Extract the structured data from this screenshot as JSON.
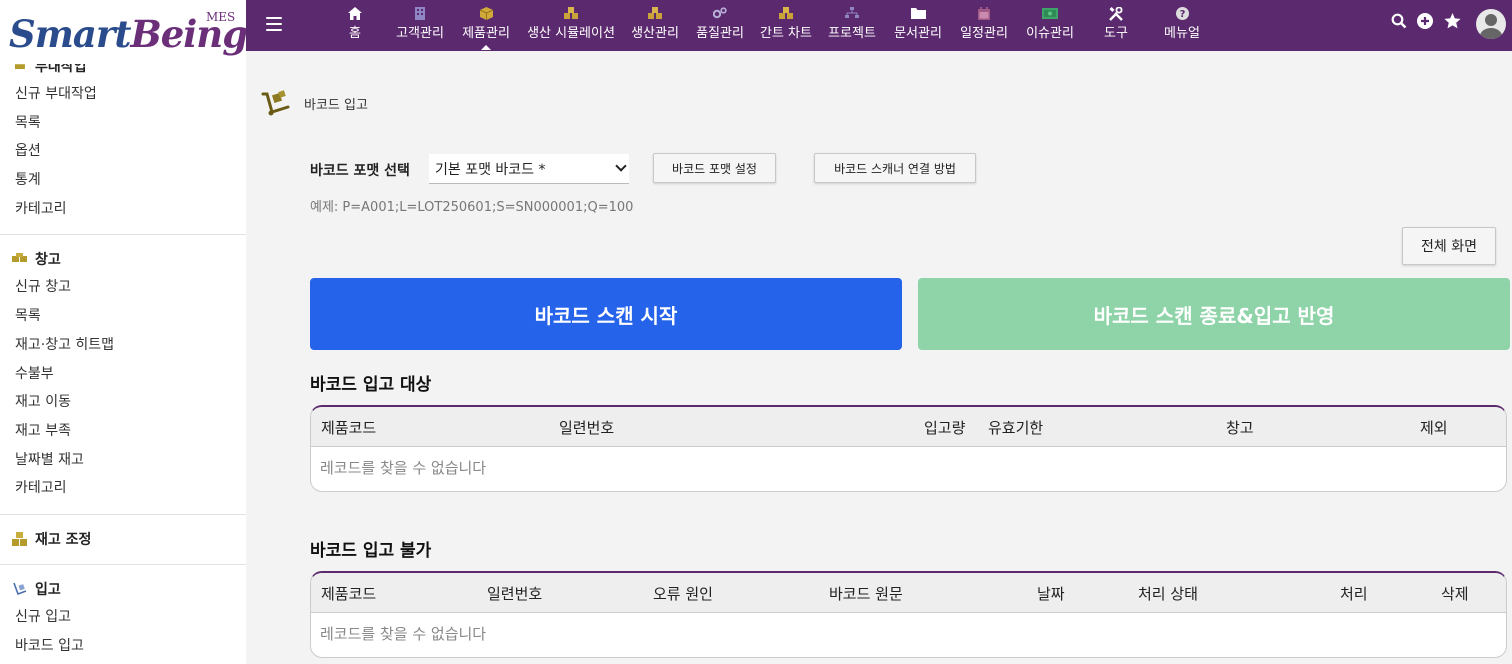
{
  "logo": {
    "brand_a": "Smart",
    "brand_b": "Being",
    "tag": "MES"
  },
  "sidebar": {
    "cut_heading": "부대작업",
    "group1": [
      "신규 부대작업",
      "목록",
      "옵션",
      "통계",
      "카테고리"
    ],
    "warehouse": {
      "heading": "창고",
      "items": [
        "신규 창고",
        "목록",
        "재고·창고 히트맵",
        "수불부",
        "재고 이동",
        "재고 부족",
        "날짜별 재고",
        "카테고리"
      ]
    },
    "adjust": {
      "heading": "재고 조정"
    },
    "inbound": {
      "heading": "입고",
      "items": [
        "신규 입고",
        "바코드 입고"
      ]
    }
  },
  "nav": [
    {
      "label": "홈",
      "icon": "home-icon"
    },
    {
      "label": "고객관리",
      "icon": "building-icon"
    },
    {
      "label": "제품관리",
      "icon": "box-icon"
    },
    {
      "label": "생산 시뮬레이션",
      "icon": "cubes-icon"
    },
    {
      "label": "생산관리",
      "icon": "cubes-icon"
    },
    {
      "label": "품질관리",
      "icon": "cogs-icon"
    },
    {
      "label": "간트 차트",
      "icon": "cubes-icon"
    },
    {
      "label": "프로젝트",
      "icon": "sitemap-icon"
    },
    {
      "label": "문서관리",
      "icon": "folder-icon"
    },
    {
      "label": "일정관리",
      "icon": "calendar-icon"
    },
    {
      "label": "이슈관리",
      "icon": "money-icon"
    },
    {
      "label": "도구",
      "icon": "tools-icon"
    },
    {
      "label": "메뉴얼",
      "icon": "question-icon"
    }
  ],
  "colors": {
    "topbar": "#5b2a6e",
    "scan_start": "#2563eb",
    "scan_end": "#8fd3a8"
  },
  "page": {
    "title": "바코드 입고",
    "format_label": "바코드 포맷 선택",
    "format_value": "기본 포맷 바코드 *",
    "format_settings": "바코드 포맷 설정",
    "scanner_help": "바코드 스캐너 연결 방법",
    "example": "예제: P=A001;L=LOT250601;S=SN000001;Q=100",
    "fullscreen": "전체 화면",
    "scan_start": "바코드 스캔 시작",
    "scan_end": "바코드 스캔 종료&입고 반영"
  },
  "table_ok": {
    "title": "바코드 입고 대상",
    "columns": [
      "제품코드",
      "일련번호",
      "입고량",
      "유효기한",
      "창고",
      "제외"
    ],
    "empty": "레코드를 찾을 수 없습니다"
  },
  "table_fail": {
    "title": "바코드 입고 불가",
    "columns": [
      "제품코드",
      "일련번호",
      "오류 원인",
      "바코드 원문",
      "날짜",
      "처리 상태",
      "처리",
      "삭제"
    ],
    "empty": "레코드를 찾을 수 없습니다"
  }
}
